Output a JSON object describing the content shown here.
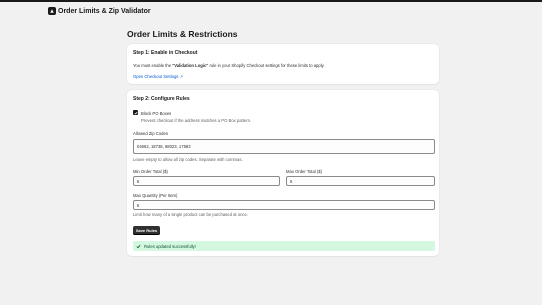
{
  "app": {
    "title": "Order Limits & Zip Validator",
    "icon": "app-logo-icon"
  },
  "page": {
    "title": "Order Limits & Restrictions"
  },
  "step1": {
    "heading": "Step 1: Enable in Checkout",
    "text_before": "You must enable the ",
    "text_bold": "\"Validation Logic\"",
    "text_after": " rule in your Shopify Checkout settings for these limits to apply.",
    "link_label": "Open Checkout Settings",
    "link_icon": "external-link-icon"
  },
  "step2": {
    "heading": "Step 2: Configure Rules",
    "po_box": {
      "label": "Block PO Boxes",
      "help": "Prevent checkout if the address matches a PO Box pattern.",
      "checked": true
    },
    "zip": {
      "label": "Allowed Zip Codes",
      "value": "04662, 18738, 68023, 17583",
      "help": "Leave empty to allow all zip codes. Separate with commas."
    },
    "min_total": {
      "label": "Min Order Total ($)",
      "value": "5"
    },
    "max_total": {
      "label": "Max Order Total ($)",
      "value": "5"
    },
    "max_qty": {
      "label": "Max Quantity (Per Item)",
      "value": "5",
      "help": "Limit how many of a single product can be purchased at once."
    },
    "save_label": "Save Rules",
    "banner": {
      "text": "Rules updated successfully!",
      "icon": "checkmark-icon"
    }
  },
  "colors": {
    "accent": "#303030",
    "link": "#005bd3",
    "success_bg": "#d4f7df",
    "success_text": "#0c5132"
  }
}
